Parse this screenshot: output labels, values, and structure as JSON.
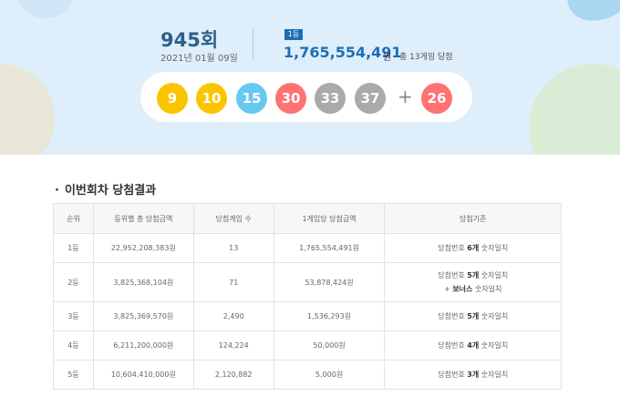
{
  "banner": {
    "draw_number": "945회",
    "date": "2021년 01월 09일",
    "rank_badge": "1등",
    "first_prize": "1,765,554,491",
    "prize_unit": "원",
    "winners_text": "총 13게임 당첨",
    "balls": [
      "9",
      "10",
      "15",
      "30",
      "33",
      "37"
    ],
    "plus": "+",
    "bonus": "26",
    "ball_colors": {
      "yellow": "#fbc400",
      "blue": "#69c8f2",
      "red": "#ff7272",
      "gray": "#aaaaaa"
    }
  },
  "section": {
    "bullet": "·",
    "title": "이번회차 당첨결과"
  },
  "table": {
    "headers": [
      "순위",
      "등위별 총 당첨금액",
      "당첨게임 수",
      "1게임당 당첨금액",
      "당첨기준"
    ],
    "rows": [
      {
        "rank": "1등",
        "total": "22,952,208,383원",
        "games": "13",
        "per_game": "1,765,554,491원",
        "crit_pre": "당첨번호 ",
        "crit_count": "6개",
        "crit_post": " 숫자일치",
        "crit_extra": ""
      },
      {
        "rank": "2등",
        "total": "3,825,368,104원",
        "games": "71",
        "per_game": "53,878,424원",
        "crit_pre": "당첨번호 ",
        "crit_count": "5개",
        "crit_post": " 숫자일치",
        "crit_extra_pre": "+ ",
        "crit_extra_bold": "보너스",
        "crit_extra_post": " 숫자일치"
      },
      {
        "rank": "3등",
        "total": "3,825,369,570원",
        "games": "2,490",
        "per_game": "1,536,293원",
        "crit_pre": "당첨번호 ",
        "crit_count": "5개",
        "crit_post": " 숫자일치",
        "crit_extra": ""
      },
      {
        "rank": "4등",
        "total": "6,211,200,000원",
        "games": "124,224",
        "per_game": "50,000원",
        "crit_pre": "당첨번호 ",
        "crit_count": "4개",
        "crit_post": " 숫자일치",
        "crit_extra": ""
      },
      {
        "rank": "5등",
        "total": "10,604,410,000원",
        "games": "2,120,882",
        "per_game": "5,000원",
        "crit_pre": "당첨번호 ",
        "crit_count": "3개",
        "crit_post": " 숫자일치",
        "crit_extra": ""
      }
    ]
  }
}
